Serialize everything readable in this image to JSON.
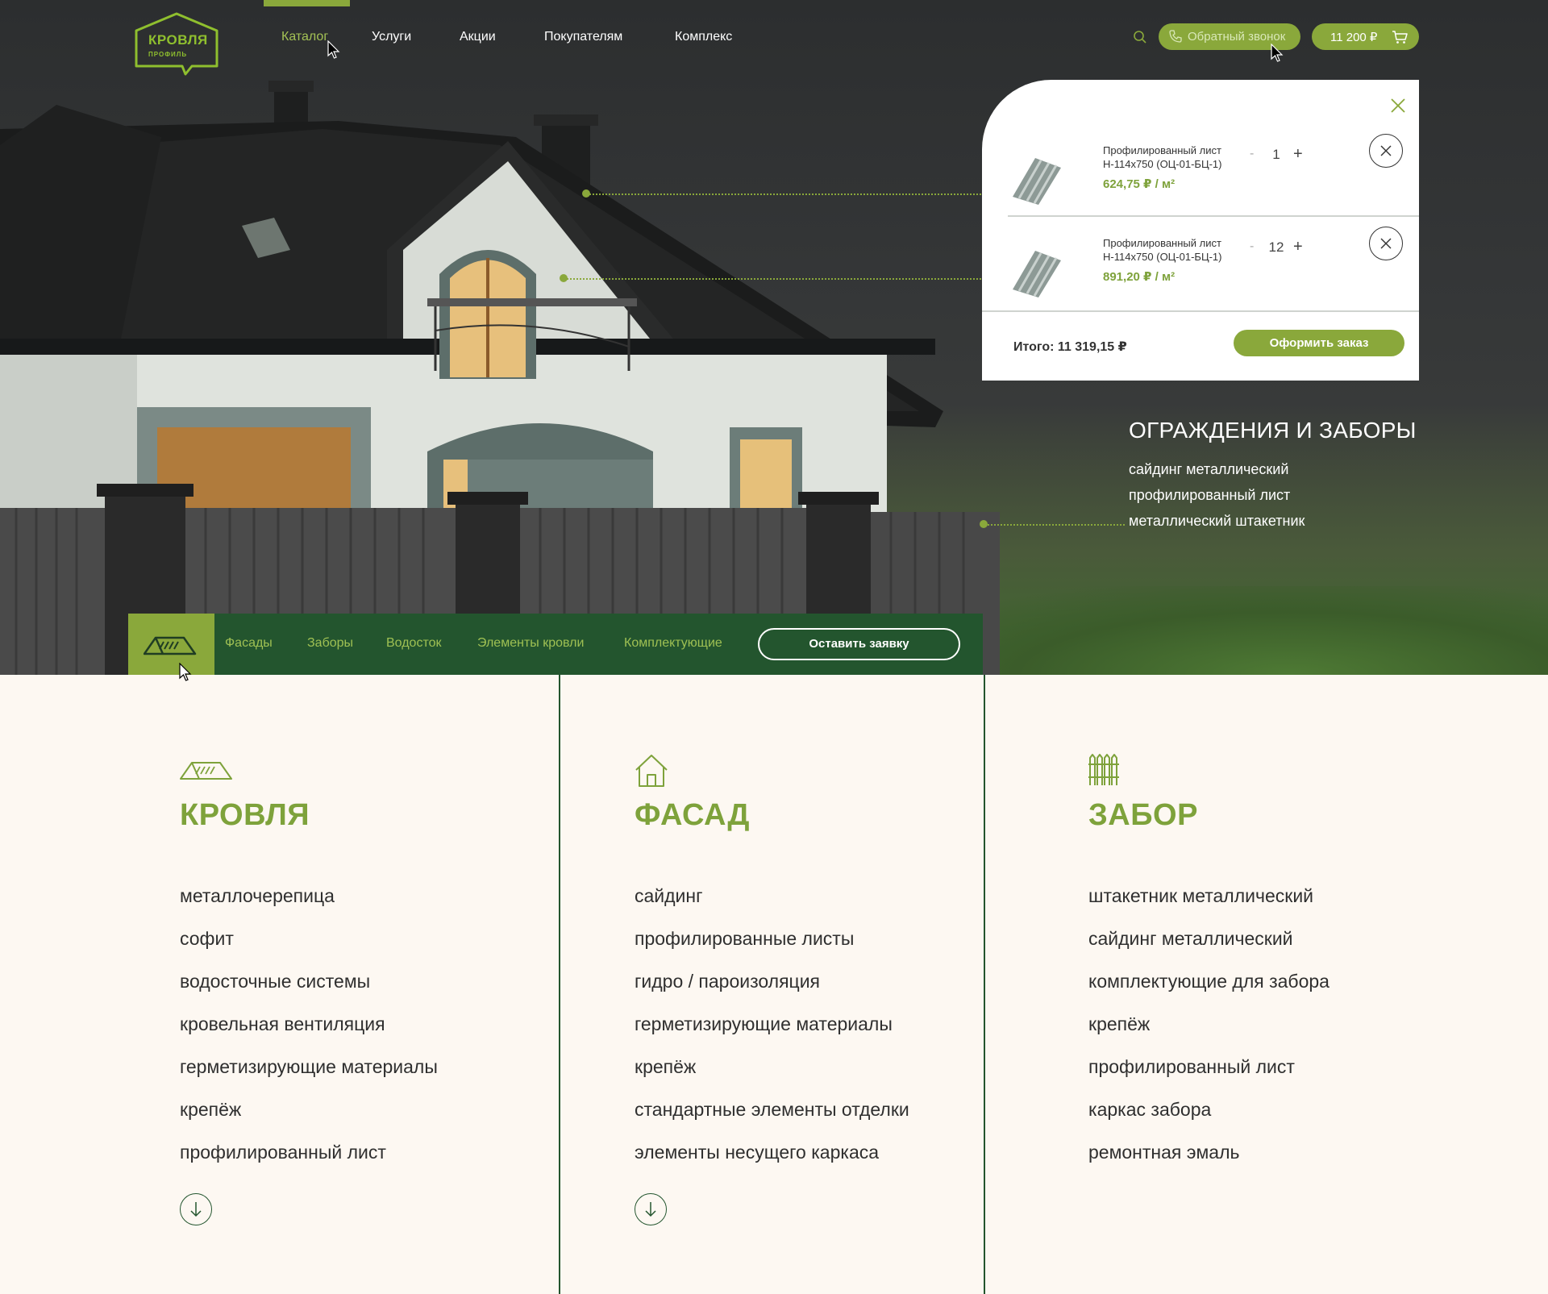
{
  "brand": {
    "logo_line1": "КРОВЛЯ",
    "logo_line2": "ПРОФИЛЬ"
  },
  "nav": [
    {
      "label": "Каталог",
      "active": true
    },
    {
      "label": "Услуги"
    },
    {
      "label": "Акции"
    },
    {
      "label": "Покупателям"
    },
    {
      "label": "Комплекс"
    }
  ],
  "header": {
    "callback_label": "Обратный звонок",
    "cart_total": "11 200 ₽"
  },
  "cart": {
    "items": [
      {
        "title": "Профилированный лист Н-114х750 (ОЦ-01-БЦ-1)",
        "price": "624,75 ₽ / м²",
        "qty": "1",
        "minus": "-",
        "plus": "+"
      },
      {
        "title": "Профилированный лист Н-114х750 (ОЦ-01-БЦ-1)",
        "price": "891,20 ₽ / м²",
        "qty": "12",
        "minus": "-",
        "plus": "+"
      }
    ],
    "total_label": "Итого: 11 319,15 ₽",
    "order_label": "Оформить заказ"
  },
  "hero": {
    "heading": "ОГРАЖДЕНИЯ И ЗАБОРЫ",
    "links": [
      "сайдинг металлический",
      "профилированный лист",
      "металлический штакетник"
    ]
  },
  "catbar": {
    "tabs": [
      "Фасады",
      "Заборы",
      "Водосток",
      "Элементы кровли",
      "Комплектующие"
    ],
    "request_label": "Оставить заявку"
  },
  "columns": [
    {
      "title": "КРОВЛЯ",
      "icon": "roof-icon",
      "items": [
        "металлочерепица",
        "софит",
        "водосточные системы",
        "кровельная вентиляция",
        "герметизирующие материалы",
        "крепёж",
        "профилированный лист"
      ],
      "has_more": true
    },
    {
      "title": "ФАСАД",
      "icon": "house-icon",
      "items": [
        "сайдинг",
        "профилированные листы",
        "гидро / пароизоляция",
        "герметизирующие материалы",
        "крепёж",
        "стандартные элементы отделки",
        "элементы несущего каркаса"
      ],
      "has_more": true
    },
    {
      "title": "ЗАБОР",
      "icon": "fence-icon",
      "items": [
        "штакетник металлический",
        "сайдинг металлический",
        "комплектующие для забора",
        "крепёж",
        "профилированный лист",
        "каркас забора",
        "ремонтная эмаль"
      ],
      "has_more": false
    }
  ],
  "colors": {
    "accent": "#8aa83b",
    "dark_green": "#23552e",
    "background": "#fdf8f2"
  }
}
